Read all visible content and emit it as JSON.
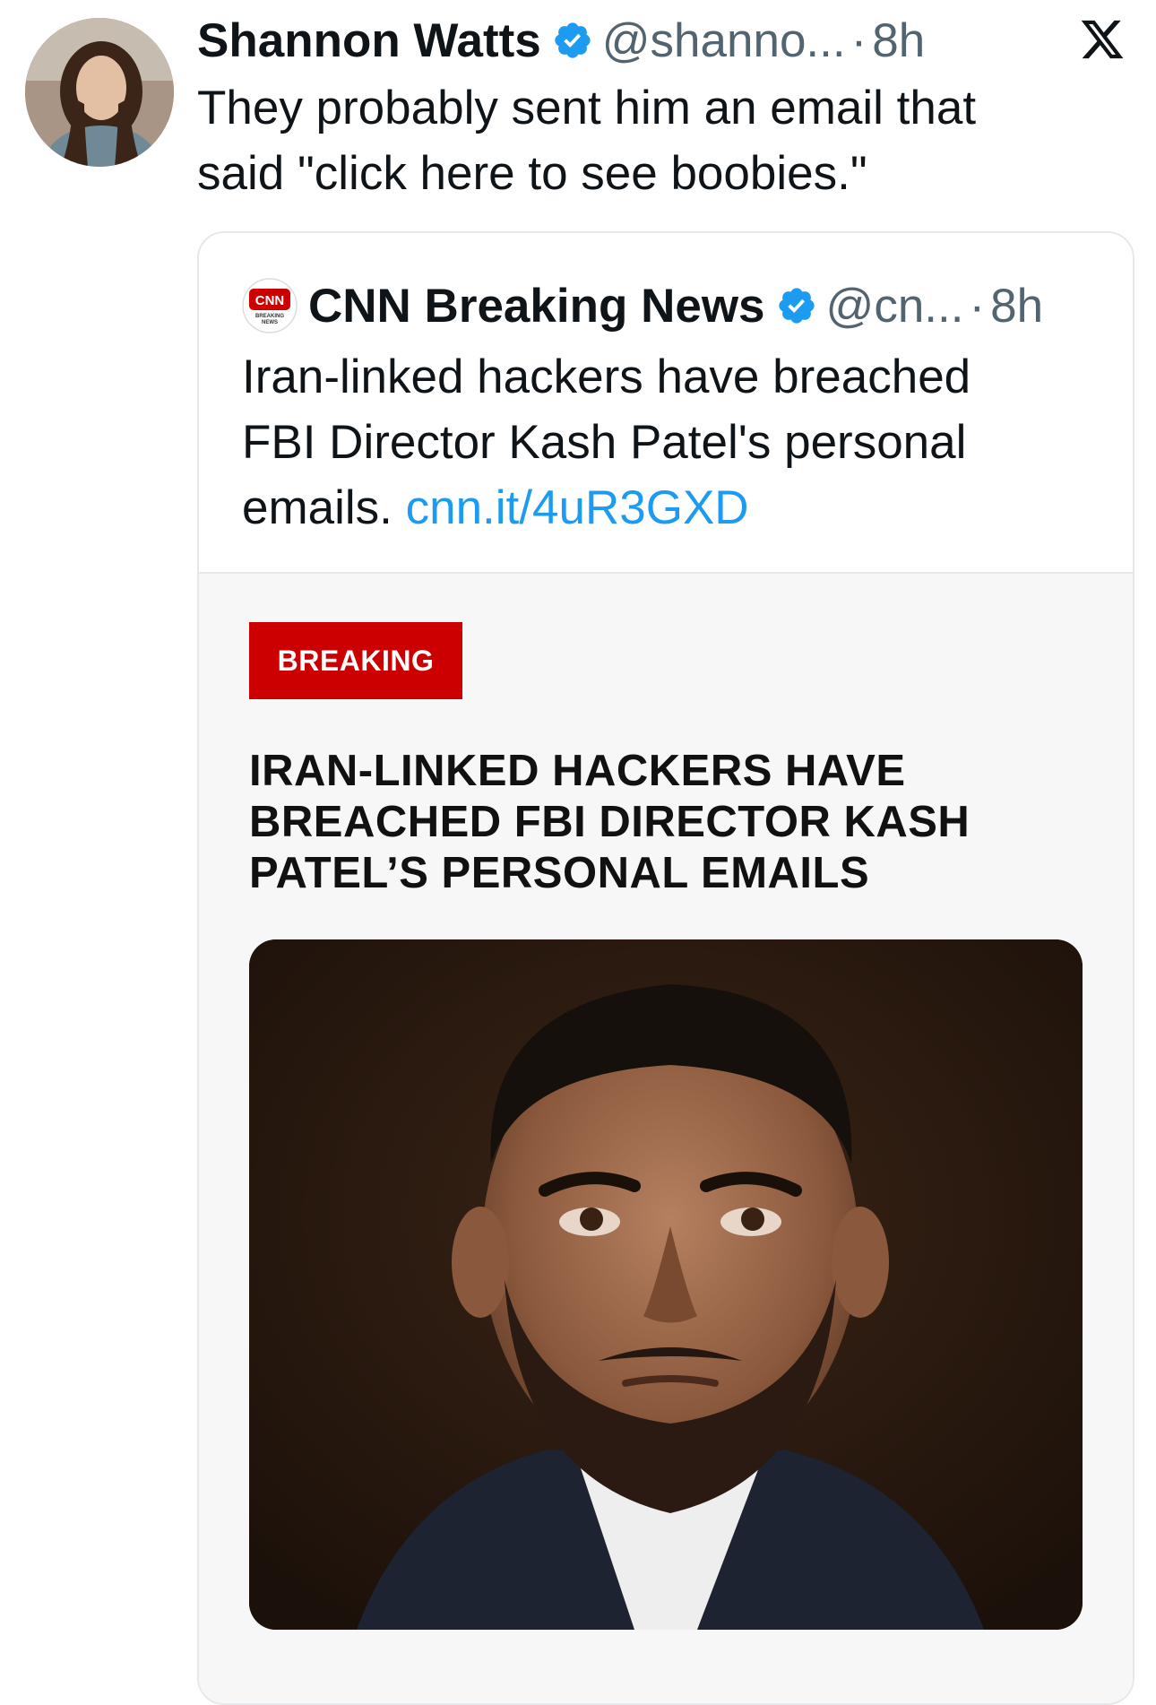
{
  "tweet": {
    "author_name": "Shannon Watts",
    "handle": "@shanno...",
    "separator": "·",
    "time": "8h",
    "text_lines": [
      "They probably sent him an email that",
      "said \"click here to see boobies.\""
    ],
    "avatar_icon": "profile-photo",
    "verified_icon": "verified-badge-icon",
    "platform_icon": "x-logo-icon"
  },
  "quote": {
    "author_name": "CNN Breaking News",
    "handle": "@cn...",
    "separator": "·",
    "time": "8h",
    "text_lines": [
      "Iran-linked hackers have breached",
      "FBI Director Kash Patel's personal"
    ],
    "text_last_prefix": "emails. ",
    "link_text": "cnn.it/4uR3GXD",
    "logo_icon": "cnn-breaking-news-logo",
    "article": {
      "badge": "BREAKING",
      "headline_lines": [
        "IRAN-LINKED HACKERS HAVE",
        "BREACHED FBI DIRECTOR KASH",
        "PATEL’S PERSONAL EMAILS"
      ],
      "photo_icon": "kash-patel-photo"
    }
  },
  "colors": {
    "text": "#0f1419",
    "muted": "#536471",
    "link": "#1d9bf0",
    "verified": "#1d9bf0",
    "breaking_red": "#cc0000",
    "card_border": "#e6e9ec"
  }
}
